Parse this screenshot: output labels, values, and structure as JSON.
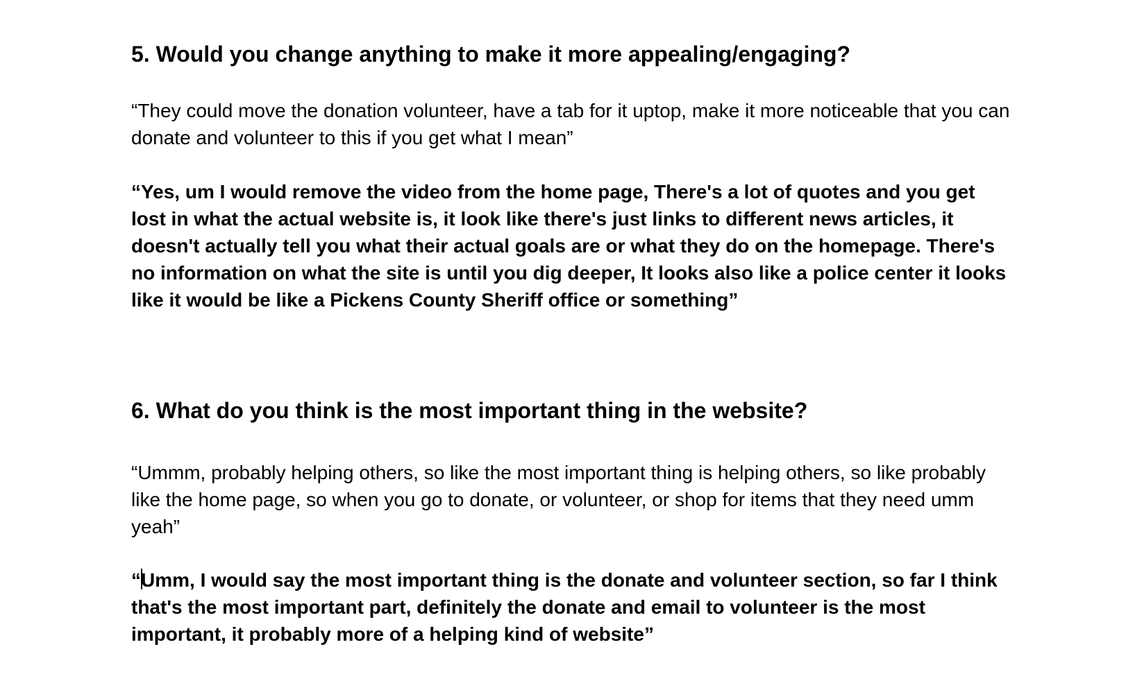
{
  "sections": [
    {
      "heading": "5. Would you change anything to make it more appealing/engaging?",
      "answers": [
        {
          "text": "“They could move the donation volunteer, have a tab for it uptop, make it more noticeable that you can donate and volunteer to this if you get what I mean”",
          "bold": false
        },
        {
          "text": "“Yes, um I would remove the video from the home page, There's a lot of quotes and you get lost in what the actual website is, it look like there's just links to different news articles, it doesn't actually tell you what their actual goals are or what they do on the homepage. There's no information on what the site is until you dig deeper, It looks also like a police center it looks like it would be like a Pickens County Sheriff office or something”",
          "bold": true
        }
      ]
    },
    {
      "heading": "6. What do you think is the most important thing in the website?",
      "answers": [
        {
          "text": "“Ummm, probably helping others, so like the most important thing is helping others, so like probably like the home page, so when you go to donate, or volunteer, or shop for items that they need umm yeah”",
          "bold": false
        },
        {
          "text_prefix": "“",
          "text": "Umm, I would say the most important thing is the donate and volunteer section, so far I think that's the most important part, definitely the donate and email to volunteer is the most important, it probably more of a helping kind of website”",
          "bold": true
        }
      ]
    }
  ]
}
